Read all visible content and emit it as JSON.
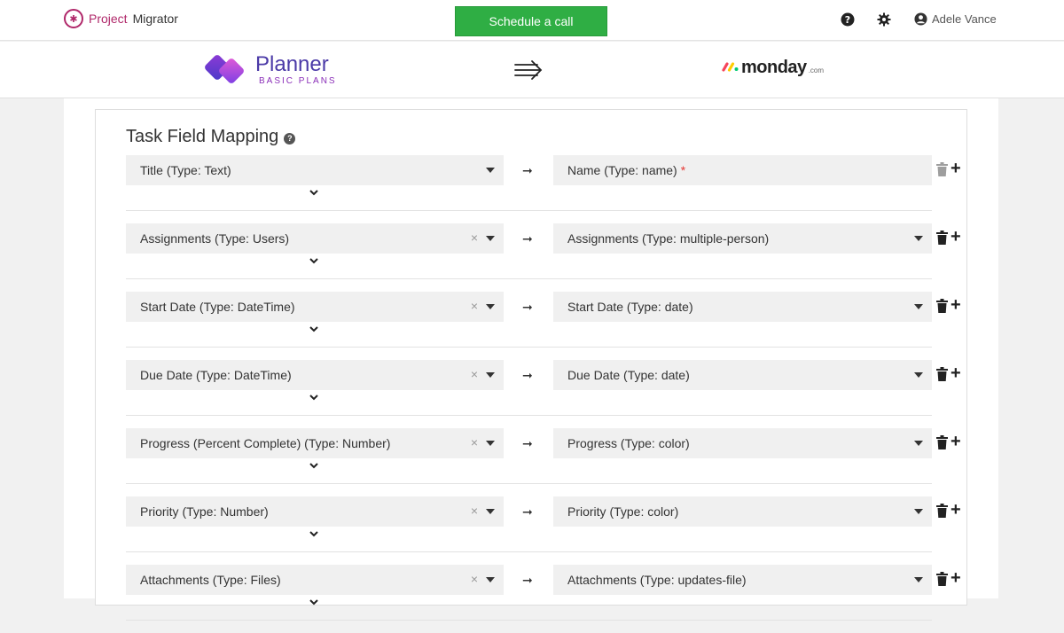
{
  "header": {
    "brand_part1": "Project",
    "brand_part2": "Migrator",
    "schedule_label": "Schedule a call",
    "user_name": "Adele Vance",
    "icons": [
      "help-circle-icon",
      "gear-icon",
      "user-circle-icon"
    ]
  },
  "logos": {
    "source_name": "Planner",
    "source_sub": "BASIC PLANS",
    "target_word": "monday",
    "target_suffix": ".com"
  },
  "mapping": {
    "title": "Task Field Mapping",
    "rows": [
      {
        "source": "Title (Type: Text)",
        "target": "Name (Type: name)",
        "required": "*",
        "clearable": false,
        "deletable": false
      },
      {
        "source": "Assignments (Type: Users)",
        "target": "Assignments (Type: multiple-person)",
        "required": "",
        "clearable": true,
        "deletable": true
      },
      {
        "source": "Start Date (Type: DateTime)",
        "target": "Start Date (Type: date)",
        "required": "",
        "clearable": true,
        "deletable": true
      },
      {
        "source": "Due Date (Type: DateTime)",
        "target": "Due Date (Type: date)",
        "required": "",
        "clearable": true,
        "deletable": true
      },
      {
        "source": "Progress (Percent Complete) (Type: Number)",
        "target": "Progress (Type: color)",
        "required": "",
        "clearable": true,
        "deletable": true
      },
      {
        "source": "Priority (Type: Number)",
        "target": "Priority (Type: color)",
        "required": "",
        "clearable": true,
        "deletable": true
      },
      {
        "source": "Attachments (Type: Files)",
        "target": "Attachments (Type: updates-file)",
        "required": "",
        "clearable": true,
        "deletable": true
      }
    ]
  },
  "colors": {
    "brand": "#b0286a",
    "primary_button": "#2fae44",
    "delete_enabled": "#222222",
    "delete_disabled": "#9e9e9e",
    "required": "#e53935"
  }
}
